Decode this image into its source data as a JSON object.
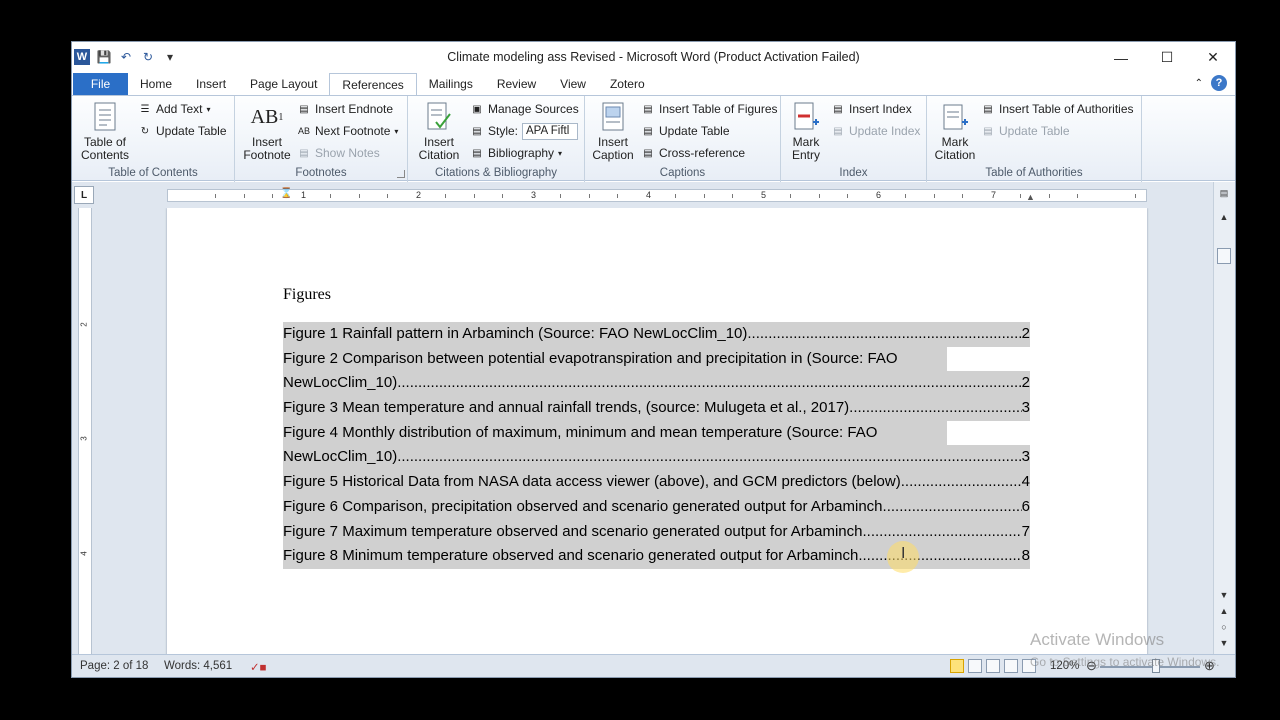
{
  "window": {
    "title": "Climate modeling ass Revised  -  Microsoft Word (Product Activation Failed)",
    "minimize": "—",
    "maximize": "☐",
    "close": "✕"
  },
  "tabs": [
    "File",
    "Home",
    "Insert",
    "Page Layout",
    "References",
    "Mailings",
    "Review",
    "View",
    "Zotero"
  ],
  "active_tab": "References",
  "ribbon": {
    "toc_group": {
      "label": "Table of Contents",
      "table_of_contents": "Table of Contents",
      "add_text": "Add Text",
      "update_table": "Update Table"
    },
    "footnotes_group": {
      "label": "Footnotes",
      "insert_footnote": "Insert Footnote",
      "insert_endnote": "Insert Endnote",
      "next_footnote": "Next Footnote",
      "show_notes": "Show Notes"
    },
    "citations_group": {
      "label": "Citations & Bibliography",
      "insert_citation": "Insert Citation",
      "manage_sources": "Manage Sources",
      "style_label": "Style:",
      "style_value": "APA Fiftl",
      "bibliography": "Bibliography"
    },
    "captions_group": {
      "label": "Captions",
      "insert_caption": "Insert Caption",
      "insert_table_of_figures": "Insert Table of Figures",
      "update_table": "Update Table",
      "cross_reference": "Cross-reference"
    },
    "index_group": {
      "label": "Index",
      "mark_entry": "Mark Entry",
      "insert_index": "Insert Index",
      "update_index": "Update Index"
    },
    "toa_group": {
      "label": "Table of Authorities",
      "mark_citation": "Mark Citation",
      "insert_toa": "Insert Table of Authorities",
      "update_table": "Update Table"
    }
  },
  "ruler": {
    "h_numbers": [
      "1",
      "2",
      "3",
      "4",
      "5",
      "6",
      "7"
    ],
    "v_numbers": [
      "2",
      "3",
      "4"
    ]
  },
  "document": {
    "heading": "Figures",
    "toc_entries": [
      {
        "text": "Figure 1 Rainfall pattern in Arbaminch (Source: FAO NewLocClim_10)",
        "page": "2"
      },
      {
        "text": "Figure 2 Comparison between potential evapotranspiration and precipitation in (Source: FAO",
        "page": ""
      },
      {
        "text": "NewLocClim_10)",
        "page": "2"
      },
      {
        "text": "Figure 3 Mean temperature and annual rainfall trends, (source: Mulugeta et al., 2017)",
        "page": "3"
      },
      {
        "text": "Figure 4 Monthly distribution of maximum, minimum and mean temperature (Source: FAO",
        "page": ""
      },
      {
        "text": "NewLocClim_10)",
        "page": "3"
      },
      {
        "text": "Figure 5 Historical Data from NASA data access viewer (above), and GCM predictors (below)",
        "page": "4"
      },
      {
        "text": "Figure 6 Comparison, precipitation observed and scenario generated output for Arbaminch",
        "page": "6"
      },
      {
        "text": "Figure 7 Maximum temperature observed and scenario generated output for Arbaminch",
        "page": "7"
      },
      {
        "text": "Figure 8 Minimum temperature observed and scenario generated output for Arbaminch",
        "page": "8"
      }
    ]
  },
  "status": {
    "page": "Page: 2 of 18",
    "words": "Words: 4,561",
    "zoom": "120%",
    "watermark_title": "Activate Windows",
    "watermark_sub": "Go to Settings to activate Windows."
  }
}
